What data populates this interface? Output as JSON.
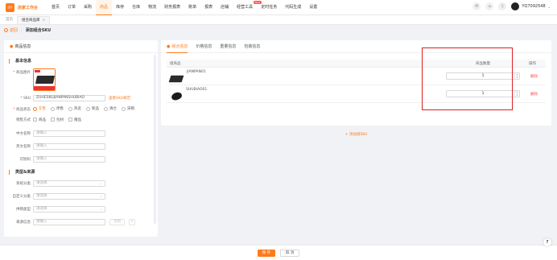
{
  "app": {
    "logo_text": "店家工作台",
    "logo_box_text": "店家\n工作台"
  },
  "nav": [
    {
      "label": "首页",
      "active": false
    },
    {
      "label": "订单",
      "active": false
    },
    {
      "label": "采购",
      "active": false
    },
    {
      "label": "商品",
      "active": true
    },
    {
      "label": "库存",
      "active": false
    },
    {
      "label": "仓库",
      "active": false
    },
    {
      "label": "物流",
      "active": false
    },
    {
      "label": "财务报表",
      "active": false
    },
    {
      "label": "账单",
      "active": false
    },
    {
      "label": "报表",
      "active": false
    },
    {
      "label": "店铺",
      "active": false
    },
    {
      "label": "经营工具",
      "active": false,
      "badge": "New"
    },
    {
      "label": "定时任务",
      "active": false
    },
    {
      "label": "代码生成",
      "active": false
    },
    {
      "label": "设置",
      "active": false
    }
  ],
  "user": {
    "name": "YQ7092548"
  },
  "tabs": [
    {
      "label": "首页",
      "closable": false
    },
    {
      "label": "组合商品库",
      "closable": true
    }
  ],
  "breadcrumb": {
    "back": "返回",
    "title": "添加组合SKU"
  },
  "left": {
    "header": "商品信息",
    "basic_title": "基本信息",
    "image_label": "商品图片",
    "sku_label": "SKU",
    "sku_value": "ZUHESKUJIANPANSHUBIAO",
    "sku_link": "查看SKU规范",
    "status_label": "商品状态",
    "status_options": [
      {
        "label": "在售",
        "on": true
      },
      {
        "label": "停售",
        "on": false
      },
      {
        "label": "热卖",
        "on": false
      },
      {
        "label": "新品",
        "on": false
      },
      {
        "label": "清仓",
        "on": false
      },
      {
        "label": "滞销",
        "on": false
      }
    ],
    "sale_label": "销售方式",
    "sale_options": [
      "商品",
      "包材",
      "赠品"
    ],
    "cn_name_label": "中文名称",
    "cn_name_placeholder": "请输入",
    "en_name_label": "英文名称",
    "en_name_placeholder": "请输入",
    "code_label": "识别码",
    "code_placeholder": "请输入",
    "type_title": "类型&来源",
    "sys_cat_label": "系统分类",
    "sys_cat_placeholder": "请选择",
    "custom_cat_label": "自定义分类",
    "custom_cat_placeholder": "请选择",
    "prod_type_label": "供销类型",
    "prod_type_placeholder": "请选择",
    "source_label": "来源信息",
    "source_placeholder": "请输入",
    "source_btn": "识别",
    "source_add": "+"
  },
  "right": {
    "tabs": [
      "组合信息",
      "价格信息",
      "重量信息",
      "包装信息"
    ],
    "active_tab": "组合信息",
    "table": {
      "headers": [
        "组商品",
        "商品数量",
        "操作"
      ],
      "rows": [
        {
          "name": "JIANPAN01",
          "qty": "1",
          "action": "删除",
          "thumb": "keyboard"
        },
        {
          "name": "SHUBIAO01",
          "qty": "1",
          "action": "删除",
          "thumb": "mouse"
        }
      ]
    },
    "add_sku": "+ 添加组SKU"
  },
  "footer": {
    "save": "保 存",
    "cancel": "取 消"
  },
  "help": "?",
  "colors": {
    "accent": "#ff7a1a",
    "danger": "#ff4d4f",
    "highlight": "#e02020"
  }
}
